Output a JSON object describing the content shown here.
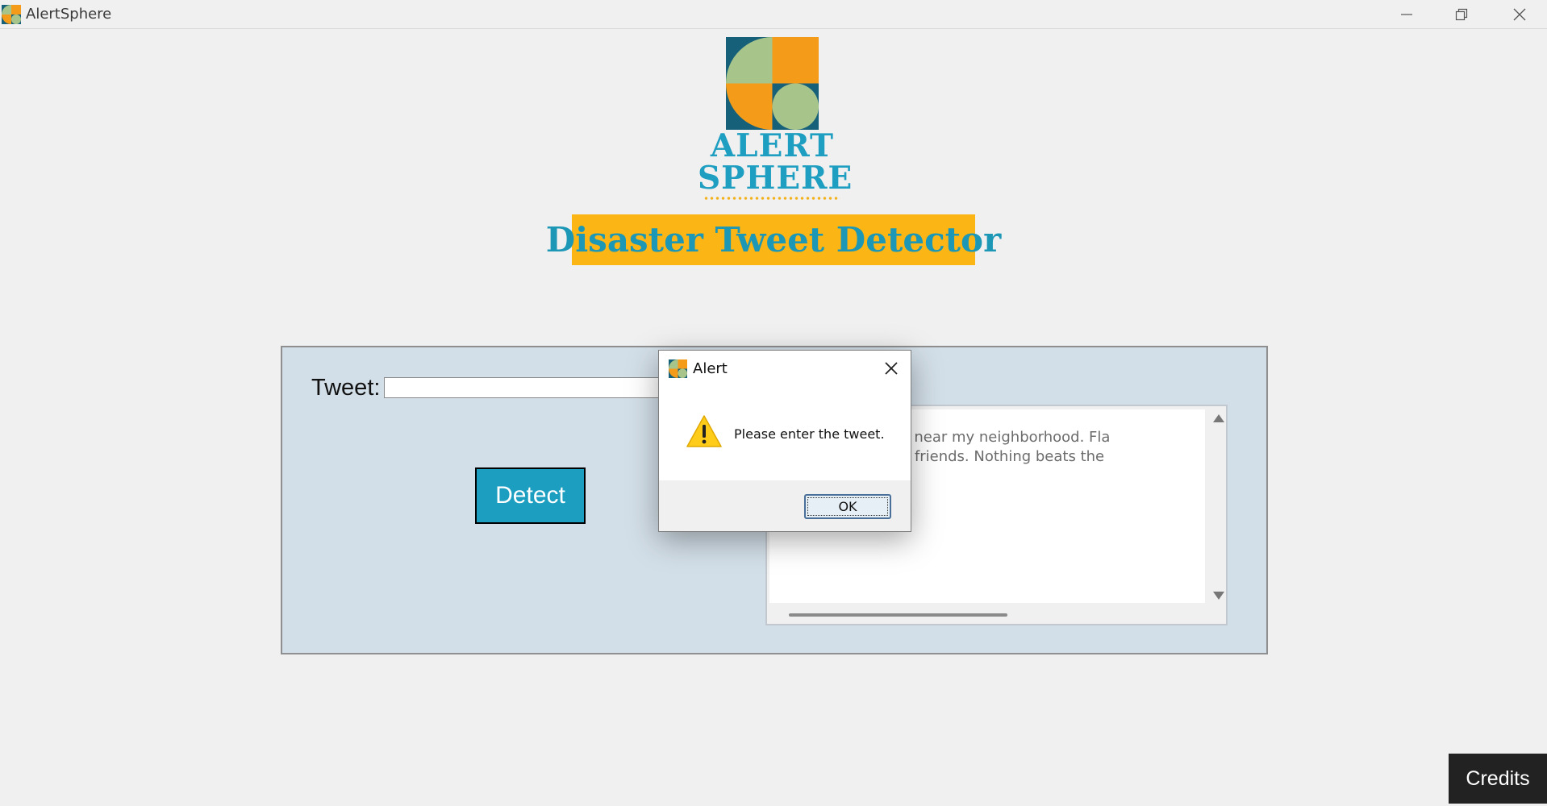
{
  "window": {
    "title": "AlertSphere",
    "icons": [
      "app-icon",
      "minimize-icon",
      "restore-icon",
      "close-icon"
    ]
  },
  "logo": {
    "line1": "ALERT",
    "line2": "SPHERE",
    "colors": {
      "green": "#a7c58a",
      "orange": "#f59b1a",
      "teal": "#17607a"
    }
  },
  "banner": {
    "text": "Disaster Tweet Detector",
    "background": "#fbb514",
    "text_color": "#1d97b6"
  },
  "form": {
    "tweet_label": "Tweet:",
    "tweet_value": "",
    "detect_label": "Detect"
  },
  "results": {
    "lines": [
      "e spreading rapidly near my neighborhood. Fla",
      "y at the beach with friends. Nothing beats the"
    ]
  },
  "credits_label": "Credits",
  "dialog": {
    "title": "Alert",
    "message": "Please enter the tweet.",
    "ok_label": "OK",
    "icon": "warning-icon"
  }
}
